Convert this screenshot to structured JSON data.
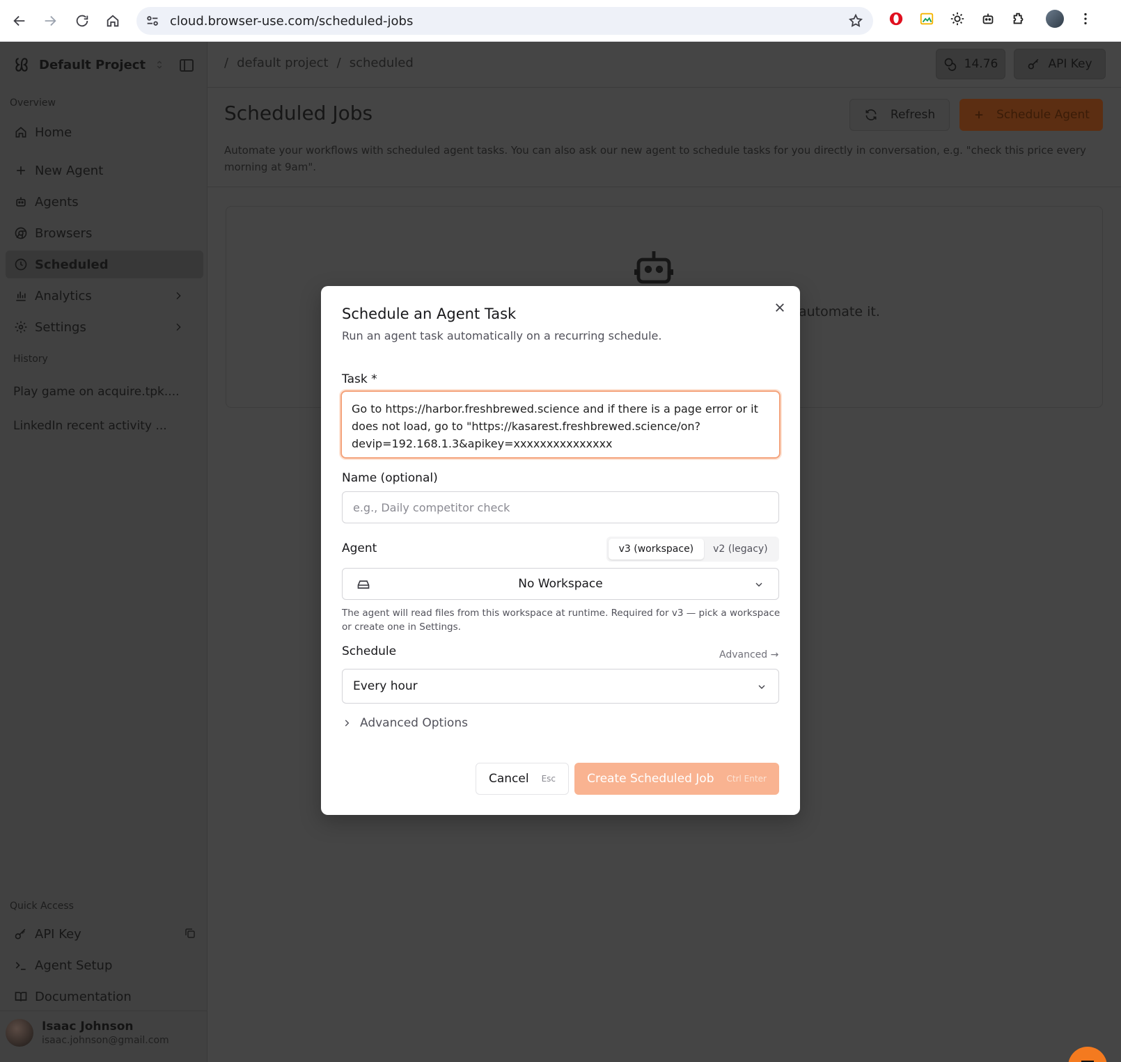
{
  "browser": {
    "url": "cloud.browser-use.com/scheduled-jobs"
  },
  "sidebar": {
    "project_name": "Default Project",
    "overview_label": "Overview",
    "items": [
      {
        "label": "Home"
      },
      {
        "label": "New Agent"
      },
      {
        "label": "Agents"
      },
      {
        "label": "Browsers"
      },
      {
        "label": "Scheduled"
      },
      {
        "label": "Analytics"
      },
      {
        "label": "Settings"
      }
    ],
    "history_label": "History",
    "history": [
      {
        "label": "Play game on acquire.tpk...."
      },
      {
        "label": "LinkedIn recent activity ..."
      }
    ],
    "quick_access_label": "Quick Access",
    "quick": [
      {
        "label": "API Key"
      },
      {
        "label": "Agent Setup"
      },
      {
        "label": "Documentation"
      }
    ],
    "user": {
      "name": "Isaac Johnson",
      "email": "isaac.johnson@gmail.com"
    }
  },
  "header": {
    "breadcrumb": [
      "default project",
      "scheduled"
    ],
    "credits": "14.76",
    "api_key_label": "API Key"
  },
  "page": {
    "title": "Scheduled Jobs",
    "refresh_label": "Refresh",
    "schedule_label": "Schedule Agent",
    "description": "Automate your workflows with scheduled agent tasks. You can also ask our new agent to schedule tasks for you directly in conversation, e.g. \"check this price every morning at 9am\".",
    "empty_text": "automate it."
  },
  "modal": {
    "title": "Schedule an Agent Task",
    "subtitle": "Run an agent task automatically on a recurring schedule.",
    "task_label": "Task *",
    "task_value": "Go to https://harbor.freshbrewed.science and if there is a page error or it does not load, go to \"https://kasarest.freshbrewed.science/on?devip=192.168.1.3&apikey=xxxxxxxxxxxxxxx",
    "name_label": "Name (optional)",
    "name_placeholder": "e.g., Daily competitor check",
    "agent_label": "Agent",
    "agent_options": [
      "v3 (workspace)",
      "v2 (legacy)"
    ],
    "workspace_value": "No Workspace",
    "workspace_help": "The agent will read files from this workspace at runtime. Required for v3 — pick a workspace or create one in Settings.",
    "schedule_label": "Schedule",
    "advanced_link": "Advanced →",
    "schedule_value": "Every hour",
    "advanced_options": "Advanced Options",
    "cancel_label": "Cancel",
    "cancel_kbd": "Esc",
    "create_label": "Create Scheduled Job",
    "create_kbd": "Ctrl Enter"
  },
  "colors": {
    "accent": "#f47a1f",
    "create_button": "#f9b391",
    "task_border": "#f4a27a"
  }
}
